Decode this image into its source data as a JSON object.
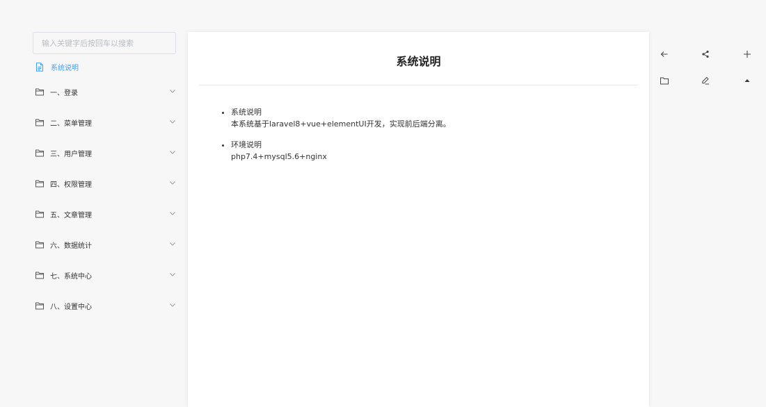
{
  "sidebar": {
    "search_placeholder": "输入关键字后按回车以搜索",
    "current_doc": "系统说明",
    "folders": [
      {
        "label": "一、登录"
      },
      {
        "label": "二、菜单管理"
      },
      {
        "label": "三、用户管理"
      },
      {
        "label": "四、权限管理"
      },
      {
        "label": "五、文章管理"
      },
      {
        "label": "六、数据统计"
      },
      {
        "label": "七、系统中心"
      },
      {
        "label": "八、设置中心"
      }
    ]
  },
  "article": {
    "title": "系统说明",
    "items": [
      {
        "heading": "系统说明",
        "text": "本系统基于laravel8+vue+elementUI开发，实现前后端分离。"
      },
      {
        "heading": "环境说明",
        "text": "php7.4+mysql5.6+nginx"
      }
    ]
  },
  "toolbar": {
    "icons": [
      "arrow-left-icon",
      "share-icon",
      "plus-icon",
      "folder-icon",
      "edit-icon",
      "caret-up-icon"
    ]
  },
  "colors": {
    "accent": "#409eff",
    "background": "#f7f7f7",
    "panel": "#ffffff"
  }
}
